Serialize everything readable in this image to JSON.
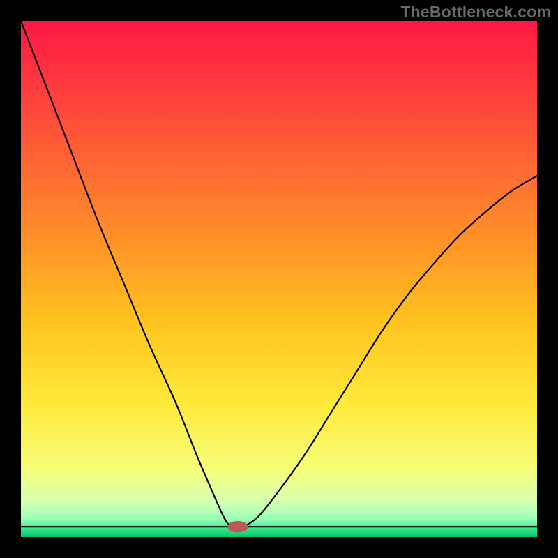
{
  "watermark": "TheBottleneck.com",
  "chart_data": {
    "type": "line",
    "title": "",
    "xlabel": "",
    "ylabel": "",
    "xlim": [
      0,
      100
    ],
    "ylim": [
      0,
      100
    ],
    "legend": false,
    "grid": false,
    "background_gradient_stops": [
      {
        "offset": 0.0,
        "color": "#ff1744"
      },
      {
        "offset": 0.18,
        "color": "#ff4a3a"
      },
      {
        "offset": 0.4,
        "color": "#ff8a2a"
      },
      {
        "offset": 0.58,
        "color": "#ffc21e"
      },
      {
        "offset": 0.74,
        "color": "#ffe93a"
      },
      {
        "offset": 0.87,
        "color": "#f6ff7a"
      },
      {
        "offset": 0.93,
        "color": "#d6ffb0"
      },
      {
        "offset": 0.965,
        "color": "#9affb8"
      },
      {
        "offset": 0.985,
        "color": "#34e38a"
      },
      {
        "offset": 1.0,
        "color": "#00c56c"
      }
    ],
    "baseline_y": 2,
    "marker": {
      "x": 42,
      "y": 2,
      "rx": 2.0,
      "ry": 1.1,
      "color": "#b85a5a"
    },
    "series": [
      {
        "name": "curve",
        "x": [
          0,
          5,
          10,
          15,
          20,
          25,
          30,
          34,
          37,
          39.5,
          41,
          43,
          46,
          50,
          55,
          60,
          65,
          70,
          75,
          80,
          85,
          90,
          95,
          100
        ],
        "y": [
          100,
          87,
          74,
          61,
          49,
          37,
          26,
          16,
          9,
          3.5,
          2,
          2,
          4,
          9,
          16,
          24,
          32,
          40,
          47,
          53,
          58.5,
          63,
          67,
          70
        ]
      }
    ]
  }
}
